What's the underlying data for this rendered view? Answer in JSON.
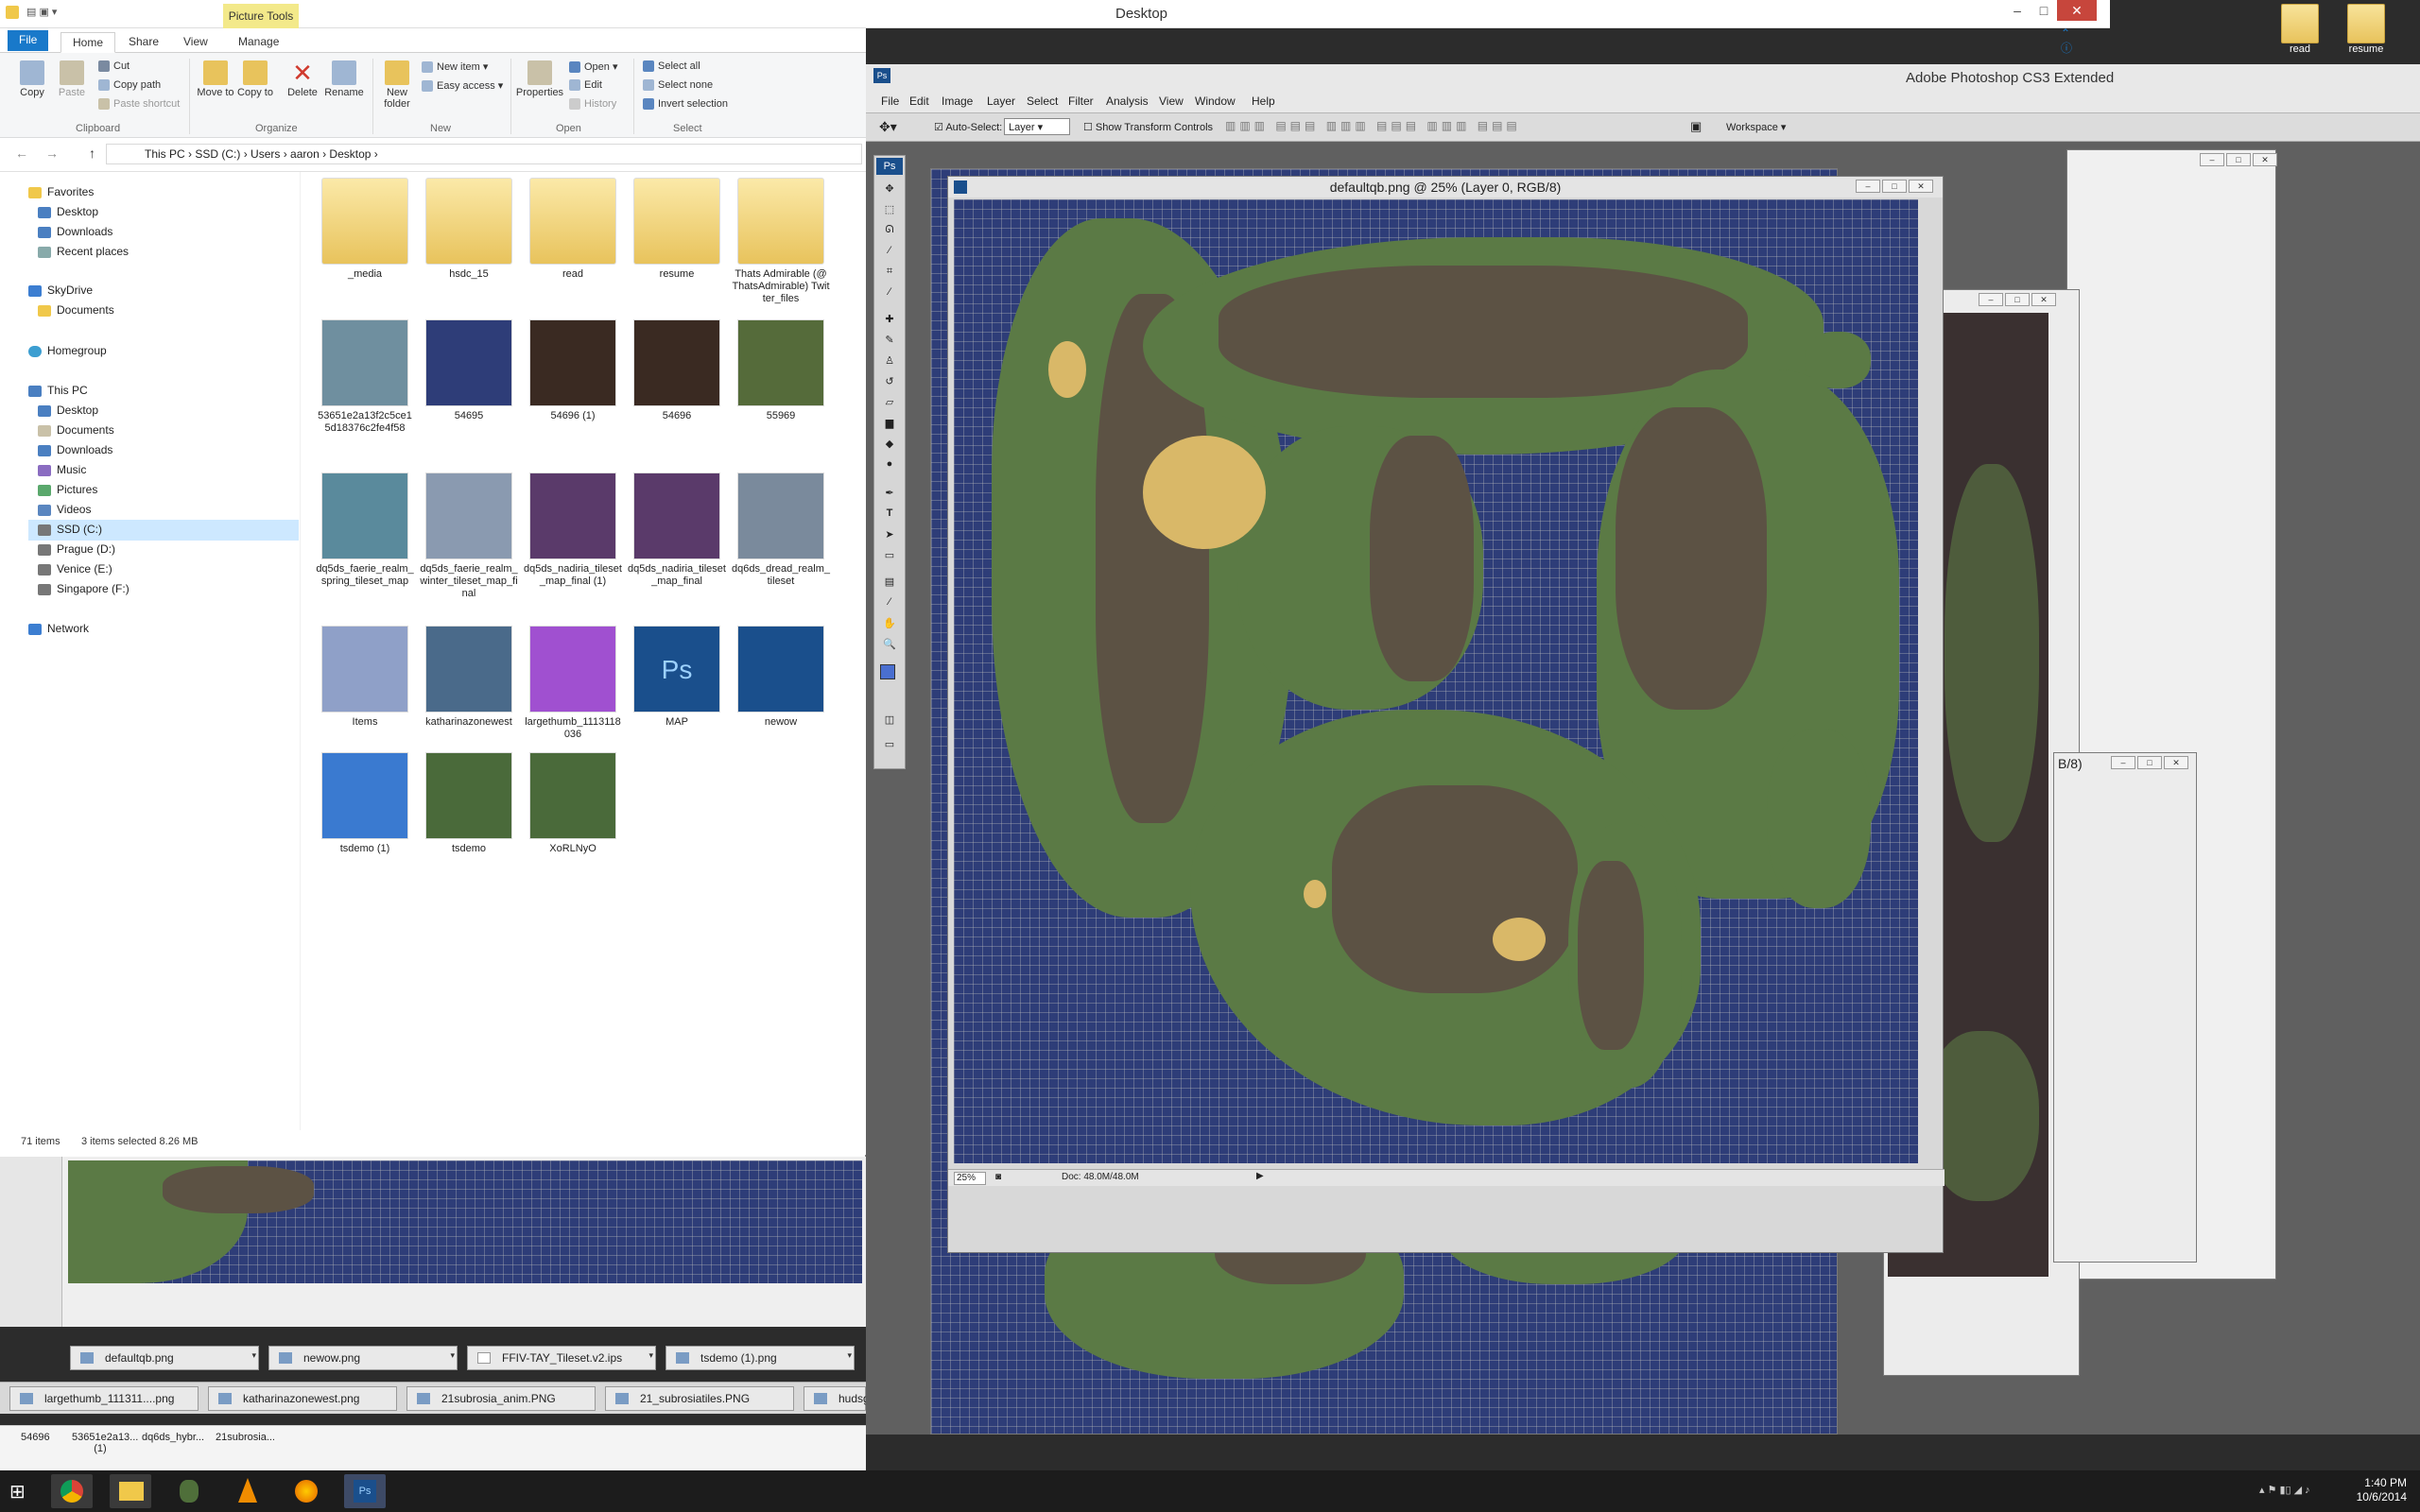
{
  "window": {
    "title": "Desktop",
    "picture_tools": "Picture Tools"
  },
  "desktop_icons": [
    "read",
    "resume"
  ],
  "ribbon": {
    "tabs": [
      "File",
      "Home",
      "Share",
      "View",
      "Manage"
    ],
    "clipboard": {
      "copy": "Copy",
      "paste": "Paste",
      "cut": "Cut",
      "copy_path": "Copy path",
      "paste_shortcut": "Paste shortcut",
      "group": "Clipboard"
    },
    "organize": {
      "move_to": "Move to",
      "copy_to": "Copy to",
      "delete": "Delete",
      "rename": "Rename",
      "group": "Organize"
    },
    "new": {
      "new_folder": "New folder",
      "new_item": "New item",
      "easy_access": "Easy access",
      "group": "New"
    },
    "open": {
      "properties": "Properties",
      "open": "Open",
      "edit": "Edit",
      "history": "History",
      "group": "Open"
    },
    "select": {
      "select_all": "Select all",
      "select_none": "Select none",
      "invert": "Invert selection",
      "group": "Select"
    }
  },
  "address": {
    "path": [
      "This PC",
      "SSD (C:)",
      "Users",
      "aaron",
      "Desktop"
    ]
  },
  "nav": {
    "favorites": "Favorites",
    "fav_items": [
      "Desktop",
      "Downloads",
      "Recent places"
    ],
    "skydrive": "SkyDrive",
    "sky_items": [
      "Documents"
    ],
    "homegroup": "Homegroup",
    "thispc": "This PC",
    "pc_items": [
      "Desktop",
      "Documents",
      "Downloads",
      "Music",
      "Pictures",
      "Videos",
      "SSD (C:)",
      "Prague (D:)",
      "Venice (E:)",
      "Singapore (F:)"
    ],
    "network": "Network"
  },
  "files": [
    {
      "name": "_media",
      "kind": "folder"
    },
    {
      "name": "hsdc_15",
      "kind": "folder"
    },
    {
      "name": "read",
      "kind": "folder"
    },
    {
      "name": "resume",
      "kind": "folder"
    },
    {
      "name": "Thats Admirable (@ThatsAdmirable)  Twitter_files",
      "kind": "folder"
    },
    {
      "name": "53651e2a13f2c5ce15d18376c2fe4f58",
      "kind": "image"
    },
    {
      "name": "54695",
      "kind": "image"
    },
    {
      "name": "54696 (1)",
      "kind": "image"
    },
    {
      "name": "54696",
      "kind": "image"
    },
    {
      "name": "55969",
      "kind": "image"
    },
    {
      "name": "dq5ds_faerie_realm_spring_tileset_map",
      "kind": "image"
    },
    {
      "name": "dq5ds_faerie_realm_winter_tileset_map_final",
      "kind": "image"
    },
    {
      "name": "dq5ds_nadiria_tileset_map_final (1)",
      "kind": "image"
    },
    {
      "name": "dq5ds_nadiria_tileset_map_final",
      "kind": "image"
    },
    {
      "name": "dq6ds_dread_realm_tileset",
      "kind": "image"
    },
    {
      "name": "Items",
      "kind": "image"
    },
    {
      "name": "katharinazonewest",
      "kind": "image"
    },
    {
      "name": "largethumb_1113118036",
      "kind": "image"
    },
    {
      "name": "MAP",
      "kind": "psd"
    },
    {
      "name": "newow",
      "kind": "image"
    },
    {
      "name": "tsdemo (1)",
      "kind": "image"
    },
    {
      "name": "tsdemo",
      "kind": "image"
    },
    {
      "name": "XoRLNyO",
      "kind": "image"
    }
  ],
  "status": {
    "count": "71 items",
    "selected": "3 items selected  8.26 MB"
  },
  "preview_tabs_row1": [
    "defaultqb.png",
    "newow.png",
    "FFIV-TAY_Tileset.v2.ips",
    "tsdemo (1).png"
  ],
  "preview_tabs_row2": [
    "largethumb_111311....png",
    "katharinazonewest.png",
    "21subrosia_anim.PNG",
    "21_subrosiatiles.PNG",
    "hudsg"
  ],
  "bottom_items": [
    "54696",
    "53651e2a13... (1)",
    "dq6ds_hybr...",
    "21subrosia..."
  ],
  "photoshop": {
    "title": "Adobe Photoshop CS3 Extended",
    "menu": [
      "File",
      "Edit",
      "Image",
      "Layer",
      "Select",
      "Filter",
      "Analysis",
      "View",
      "Window",
      "Help"
    ],
    "options": {
      "auto_select": "Auto-Select:",
      "layer": "Layer",
      "transform": "Show Transform Controls",
      "workspace": "Workspace"
    },
    "doc_title": "defaultqb.png @ 25% (Layer 0, RGB/8)",
    "zoom": "25%",
    "doc_size": "Doc: 48.0M/48.0M",
    "back_doc_frag": "B/8)"
  },
  "clock": {
    "time": "1:40 PM",
    "date": "10/6/2014"
  },
  "colors": {
    "accent": "#1979ca",
    "water": "#2e3d78",
    "grass": "#5b7a45",
    "mountain": "#5c5244",
    "sand": "#d9b868"
  }
}
